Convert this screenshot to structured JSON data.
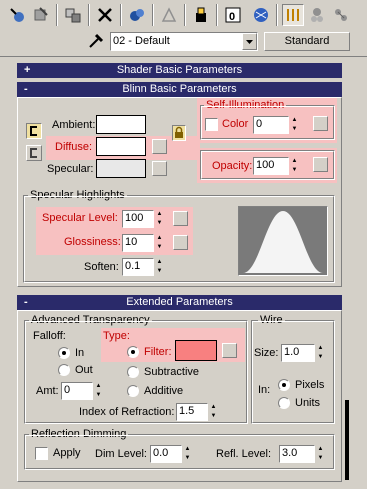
{
  "toolbar": {
    "icons": [
      "pick-material-icon",
      "put-material-icon",
      "assign-material-icon",
      "reset-map-icon",
      "copy-material-icon",
      "unique-icon",
      "put-library-icon",
      "material-effects-channel-icon",
      "show-map-icon",
      "show-end-result-icon",
      "go-to-parent-icon",
      "go-forward-sibling-icon",
      "eyedropper-icon"
    ],
    "material_name": "02 - Default",
    "material_type": "Standard"
  },
  "shader_basic": {
    "sign": "+",
    "title": "Shader Basic Parameters"
  },
  "blinn_basic": {
    "sign": "-",
    "title": "Blinn Basic Parameters",
    "ambient_label": "Ambient:",
    "diffuse_label": "Diffuse:",
    "specular_label": "Specular:",
    "self_illum": {
      "title": "Self-Illumination",
      "color_label": "Color",
      "value": "0"
    },
    "opacity": {
      "label": "Opacity:",
      "value": "100"
    },
    "specular_highlights": {
      "title": "Specular Highlights",
      "specular_level_label": "Specular Level:",
      "specular_level": "100",
      "glossiness_label": "Glossiness:",
      "glossiness": "10",
      "soften_label": "Soften:",
      "soften": "0.1"
    },
    "colors": {
      "ambient": "#ffffff",
      "diffuse": "#ffffff",
      "specular": "#e8e8e8",
      "highlight_bg": "#f7c1c1"
    }
  },
  "extended": {
    "sign": "-",
    "title": "Extended Parameters",
    "advanced_transparency": {
      "title": "Advanced Transparency",
      "falloff_label": "Falloff:",
      "in_label": "In",
      "out_label": "Out",
      "amt_label": "Amt:",
      "amt": "0",
      "type_label": "Type:",
      "filter_label": "Filter:",
      "subtractive_label": "Subtractive",
      "additive_label": "Additive",
      "filter_color": "#f88080",
      "ior_label": "Index of Refraction:",
      "ior": "1.5"
    },
    "wire": {
      "title": "Wire",
      "size_label": "Size:",
      "size": "1.0",
      "in_label": "In:",
      "pixels_label": "Pixels",
      "units_label": "Units"
    },
    "reflection_dimming": {
      "title": "Reflection Dimming",
      "apply_label": "Apply",
      "dim_level_label": "Dim Level:",
      "dim_level": "0.0",
      "refl_level_label": "Refl. Level:",
      "refl_level": "3.0"
    }
  }
}
